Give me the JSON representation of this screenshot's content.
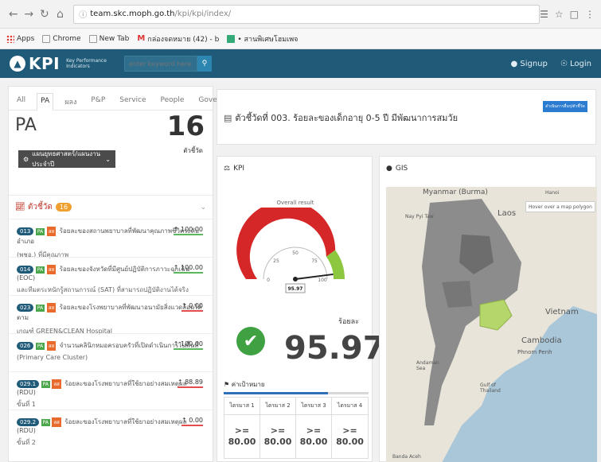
{
  "browser": {
    "url_host": "team.skc.moph.go.th",
    "url_path": "/kpi/kpi/index/",
    "bookmarks": [
      "Apps",
      "Chrome",
      "New Tab",
      "กล่องจดหมาย (42) - b",
      "• สานพิเศษโฮมเพจ"
    ]
  },
  "navbar": {
    "logo_text": "KPI",
    "logo_sub_1": "Key Performance",
    "logo_sub_2": "Indicators",
    "search_placeholder": "enter keyword here...",
    "signup": "Signup",
    "login": "Login"
  },
  "left": {
    "tabs": [
      "All",
      "PA",
      "ผลง",
      "P&P",
      "Service",
      "People",
      "Governance"
    ],
    "active_tab": "PA",
    "title": "PA",
    "count": "16",
    "count_unit": "ตัวชี้วัด",
    "dropdown_label": "แผนยุทธศาสตร์/แผนงาน ประจำปี",
    "indicators_header": "ตัวชี้วัด",
    "indicators_count": "16",
    "indicators": [
      {
        "code": "013",
        "text1": "ร้อยละของสถานพยาบาลที่พัฒนาคุณภาพชีวิตระดับอำเภอ",
        "text2": "(พชอ.) ที่มีคุณภาพ",
        "value": "100.00",
        "bar": "green"
      },
      {
        "code": "014",
        "text1": "ร้อยละของจังหวัดที่มีศูนย์ปฏิบัติการภาวะฉุกเฉิน (EOC)",
        "text2": "และทีมตระหนักรู้สถานการณ์ (SAT) ที่สามารถปฏิบัติงานได้จริง",
        "value": "100.00",
        "bar": "green"
      },
      {
        "code": "023",
        "text1": "ร้อยละของโรงพยาบาลที่พัฒนาอนามัยสิ่งแวดล้อมได้ตาม",
        "text2": "เกณฑ์ GREEN&CLEAN Hospital",
        "value": "0.00",
        "bar": "red"
      },
      {
        "code": "026",
        "text1": "จำนวนคลินิกหมอครอบครัวที่เปิดดำเนินการในพื้นที่",
        "text2": "(Primary Care Cluster)",
        "value": "100.00",
        "bar": "green"
      },
      {
        "code": "029.1",
        "text1": "ร้อยละของโรงพยาบาลที่ใช้ยาอย่างสมเหตุผล (RDU)",
        "text2": "ขั้นที่ 1",
        "value": "88.89",
        "bar": "red"
      },
      {
        "code": "029.2",
        "text1": "ร้อยละของโรงพยาบาลที่ใช้ยาอย่างสมเหตุผล (RDU)",
        "text2": "ขั้นที่ 2",
        "value": "0.00",
        "bar": "red"
      }
    ]
  },
  "title_panel": {
    "title": "ตัวชี้วัดที่ 003. ร้อยละของเด็กอายุ 0-5 ปี มีพัฒนาการสมวัย",
    "button": "ดำเนินการอื่นๆ/ตัวชี้วัด"
  },
  "kpi": {
    "header": "KPI",
    "gauge_title": "Overall result",
    "gauge_value": 95.97,
    "gauge_value_label": "95.97",
    "gauge_ticks": [
      "0",
      "25",
      "50",
      "75",
      "100"
    ],
    "unit": "ร้อยละ",
    "big_value": "95.97",
    "target_header": "ค่าเป้าหมาย",
    "target_progress": 0.72,
    "quarters": [
      "ไตรมาส 1",
      "ไตรมาส 2",
      "ไตรมาส 3",
      "ไตรมาส 4"
    ],
    "quarter_ops": [
      ">=",
      ">=",
      ">=",
      ">="
    ],
    "quarter_values": [
      "80.00",
      "80.00",
      "80.00",
      "80.00"
    ]
  },
  "gis": {
    "header": "GIS",
    "hover_hint": "Hover over a map polygon",
    "labels": [
      "Myanmar (Burma)",
      "Laos",
      "Vietnam",
      "Cambodia",
      "Phnom Penh",
      "Andaman Sea",
      "Gulf of Thailand",
      "Nay Pyi Taw",
      "Banda Aceh",
      "Hanoi"
    ]
  },
  "colors": {
    "navbar": "#1f5b78",
    "accent": "#2b7bd0",
    "success": "#3fa142",
    "gauge_red": "#d62728",
    "gauge_green": "#8dc63f"
  }
}
